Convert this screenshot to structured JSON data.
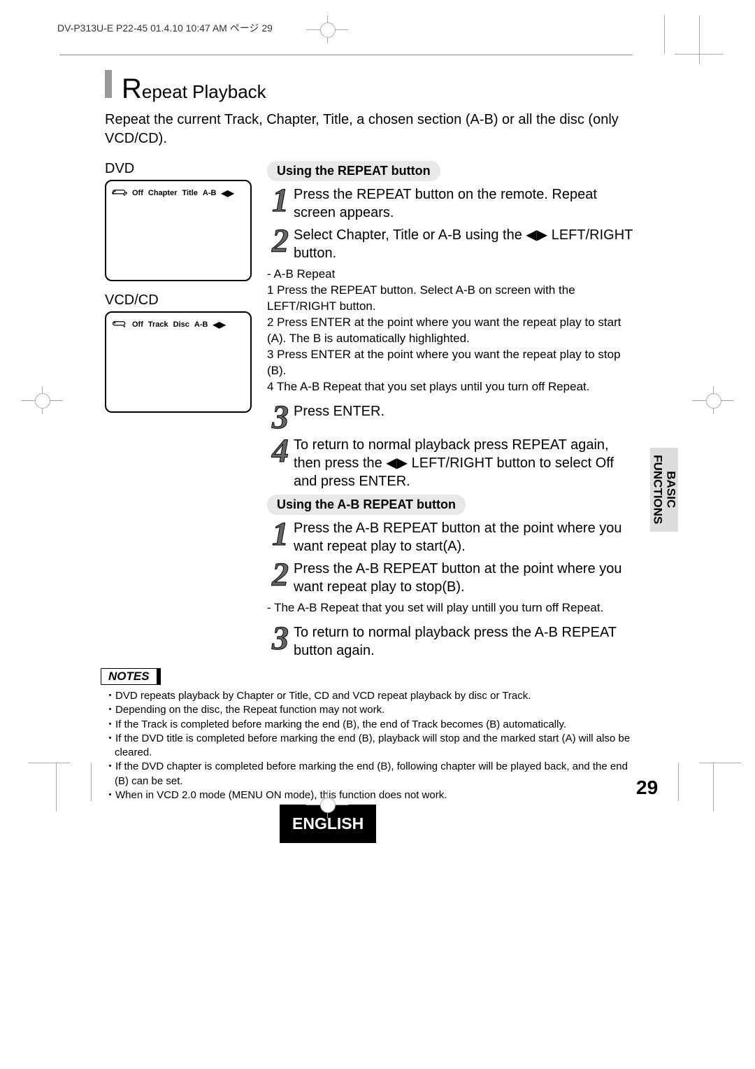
{
  "header": "DV-P313U-E P22-45  01.4.10 10:47 AM  ページ 29",
  "title": {
    "first": "R",
    "rest": "epeat Playback"
  },
  "intro": "Repeat the current Track, Chapter, Title, a chosen section (A-B) or all the disc (only VCD/CD).",
  "dvd": {
    "label": "DVD",
    "items": [
      "Off",
      "Chapter",
      "Title",
      "A-B"
    ]
  },
  "vcd": {
    "label": "VCD/CD",
    "items": [
      "Off",
      "Track",
      "Disc",
      "A-B"
    ]
  },
  "sectionA": {
    "heading": "Using the REPEAT button",
    "steps": [
      "Press the REPEAT button on the remote. Repeat screen appears.",
      "Select Chapter, Title or A-B using the ◀▶ LEFT/RIGHT button."
    ],
    "sub": [
      "-  A-B Repeat",
      "1 Press the REPEAT button. Select A-B on screen with the LEFT/RIGHT button.",
      "2 Press ENTER at the point where you want the repeat play to start (A). The B is automatically highlighted.",
      "3 Press ENTER at the point where you want the repeat play to stop (B).",
      "4 The A-B Repeat that you set plays until you turn off Repeat."
    ],
    "steps2": [
      "Press ENTER.",
      "To return to normal playback press REPEAT again, then press the ◀▶ LEFT/RIGHT button to select Off and press ENTER."
    ]
  },
  "sectionB": {
    "heading": "Using the A-B REPEAT button",
    "steps": [
      "Press the A-B REPEAT button at the point where you want repeat play to start(A).",
      "Press the A-B REPEAT button at the point where you want repeat play to stop(B)."
    ],
    "note": "- The A-B Repeat that you set will play untill you turn off Repeat.",
    "steps2": [
      "To return to normal playback press the A-B REPEAT button again."
    ]
  },
  "notesLabel": "NOTES",
  "notes": [
    "DVD repeats playback by Chapter or Title, CD and VCD repeat playback by disc or Track.",
    "Depending on the disc, the Repeat function may not work.",
    "If the Track is completed before marking the end (B), the end of Track becomes (B) automatically.",
    "If the DVD title is completed before marking the end (B), playback will stop and the marked start (A) will also be cleared.",
    "If the DVD chapter is completed before marking the end (B), following chapter will be played back, and the end (B) can be set.",
    "When in VCD 2.0 mode (MENU ON mode), this function does not work."
  ],
  "sideTab": {
    "line1": "BASIC",
    "line2": "FUNCTIONS"
  },
  "pageNumber": "29",
  "language": "ENGLISH"
}
